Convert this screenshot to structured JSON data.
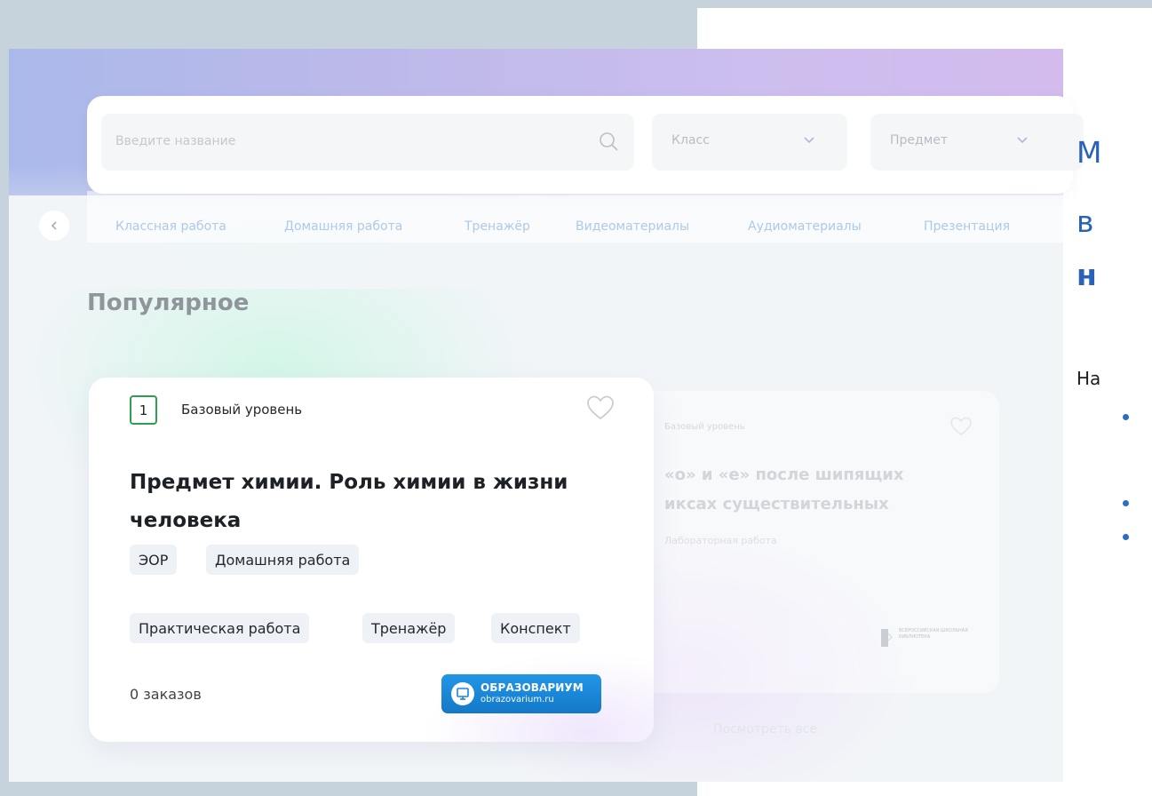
{
  "search": {
    "placeholder": "Введите название"
  },
  "filters": {
    "class_label": "Класс",
    "subject_label": "Предмет"
  },
  "tabs": [
    {
      "label": "Классная работа"
    },
    {
      "label": "Домашняя работа"
    },
    {
      "label": "Тренажёр"
    },
    {
      "label": "Видеоматериалы"
    },
    {
      "label": "Аудиоматериалы"
    },
    {
      "label": "Презентация"
    }
  ],
  "section": {
    "title": "Популярное",
    "see_all": "Посмотреть все"
  },
  "card": {
    "grade": "1",
    "level": "Базовый уровень",
    "title": "Предмет химии. Роль химии в жизни человека",
    "chips": [
      "ЭОР",
      "Домашняя работа",
      "Практическая работа",
      "Тренажёр",
      "Конспект"
    ],
    "orders": "0 заказов",
    "brand_name": "ОБРАЗОВАРИУМ",
    "brand_url": "obrazovarium.ru"
  },
  "ghost_card": {
    "level": "Базовый уровень",
    "title": "«о» и «е» после шипящих\nиксах существительных",
    "tag": "Лабораторная работа",
    "logo_text": "ВСЕРОССИЙСКАЯ ШКОЛЬНАЯ БИБЛИОТЕКА"
  },
  "slide": {
    "line1": "М",
    "line2": "в",
    "line3": "н",
    "small": "На"
  },
  "colors": {
    "accent": "#2a62b8",
    "brand": "#1a86d8",
    "grade_border": "#2f9e4f"
  }
}
